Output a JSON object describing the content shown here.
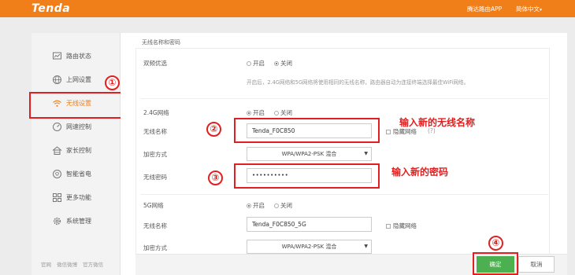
{
  "header": {
    "logo": "Tenda",
    "app_link": "腾达路由APP",
    "language": "简体中文",
    "language_caret": "▾"
  },
  "sidebar": {
    "items": [
      {
        "label": "路由状态",
        "icon": "monitor-icon"
      },
      {
        "label": "上网设置",
        "icon": "globe-icon"
      },
      {
        "label": "无线设置",
        "icon": "wifi-icon"
      },
      {
        "label": "网速控制",
        "icon": "speedometer-icon"
      },
      {
        "label": "家长控制",
        "icon": "house-icon"
      },
      {
        "label": "智能省电",
        "icon": "bulb-icon"
      },
      {
        "label": "更多功能",
        "icon": "grid-icon"
      },
      {
        "label": "系统管理",
        "icon": "gear-icon"
      }
    ],
    "active_index": 2,
    "footer_links": [
      "官网",
      "微信微博",
      "官方微信"
    ]
  },
  "content": {
    "section_title": "无线名称和密码",
    "dual_band": {
      "label": "双频优选",
      "on_label": "开启",
      "off_label": "关闭",
      "selected": "off",
      "hint": "开启后，2.4G网络和5G网络将使用相同的无线名称，路由器自动为连接终端选择最佳WiFi网络。"
    },
    "band24": {
      "title": "2.4G网络",
      "on_label": "开启",
      "off_label": "关闭",
      "selected": "on",
      "ssid_label": "无线名称",
      "ssid_value": "Tenda_F0C850",
      "hide_label": "隐藏网络",
      "help": "(?)",
      "encryption_label": "加密方式",
      "encryption_value": "WPA/WPA2-PSK 混合",
      "password_label": "无线密码",
      "password_value": "••••••••••"
    },
    "band5": {
      "title": "5G网络",
      "on_label": "开启",
      "off_label": "关闭",
      "selected": "on",
      "ssid_label": "无线名称",
      "ssid_value": "Tenda_F0C850_5G",
      "hide_label": "隐藏网络",
      "encryption_label": "加密方式",
      "encryption_value": "WPA/WPA2-PSK 混合"
    }
  },
  "annotations": {
    "step1": "①",
    "step2": "②",
    "step3": "③",
    "step4": "④",
    "ssid_note": "输入新的无线名称",
    "password_note": "输入新的密码",
    "color": "#e02020"
  },
  "buttons": {
    "ok": "确定",
    "cancel": "取消"
  },
  "colors": {
    "brand": "#f07f1a",
    "ok_button": "#4caf50"
  }
}
